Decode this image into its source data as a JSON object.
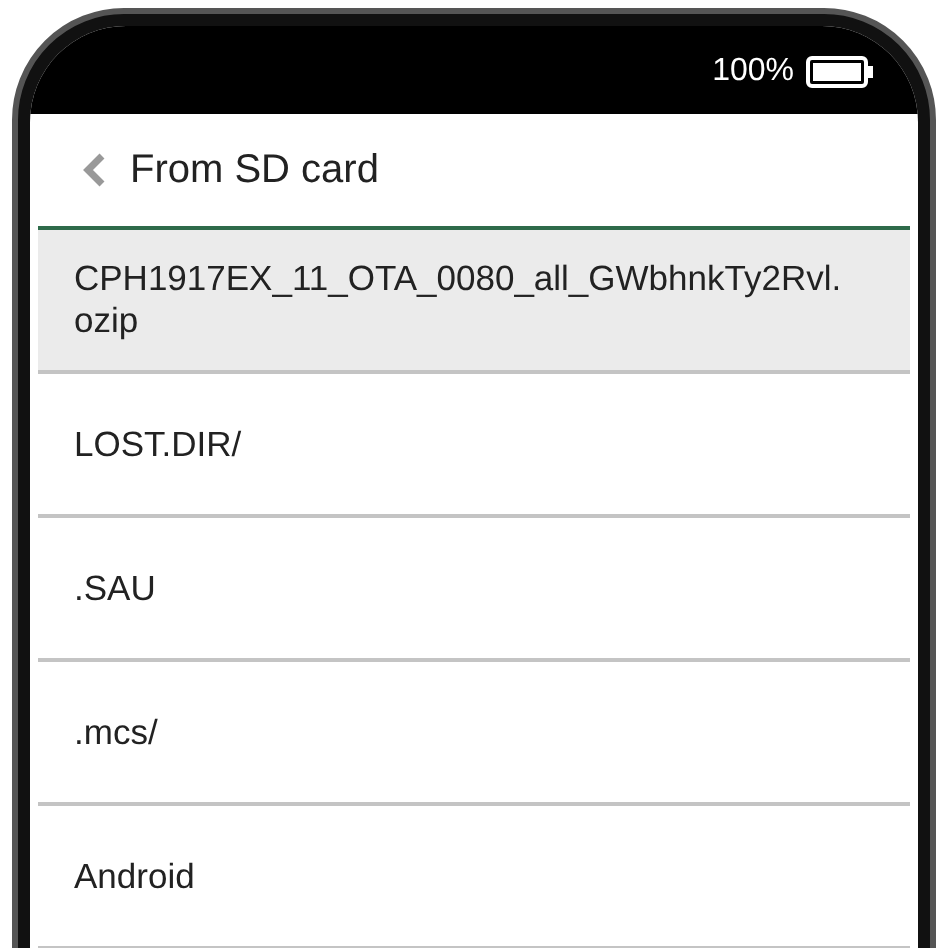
{
  "status_bar": {
    "battery_text": "100%"
  },
  "header": {
    "title": "From SD card"
  },
  "files": [
    {
      "name": "CPH1917EX_11_OTA_0080_all_GWbhnkTy2Rvl.ozip",
      "selected": true
    },
    {
      "name": "LOST.DIR/",
      "selected": false
    },
    {
      "name": ".SAU",
      "selected": false
    },
    {
      "name": ".mcs/",
      "selected": false
    },
    {
      "name": "Android",
      "selected": false
    }
  ]
}
